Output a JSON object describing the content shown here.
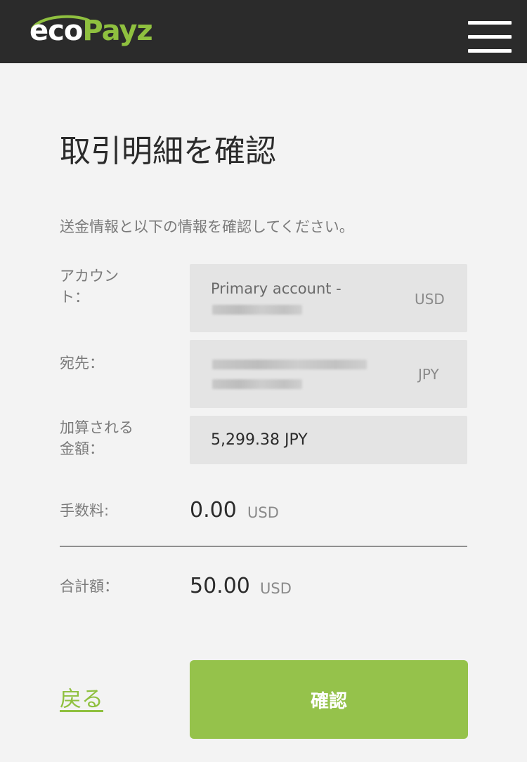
{
  "header": {
    "logo_eco": "eco",
    "logo_payz": "Payz",
    "menu_icon": "hamburger-menu-icon"
  },
  "page": {
    "title": "取引明細を確認",
    "subtitle": "送金情報と以下の情報を確認してください。"
  },
  "fields": {
    "account": {
      "label_line1": "アカウン",
      "label_line2": "ト：",
      "value": "Primary account -",
      "currency": "USD"
    },
    "recipient": {
      "label": "宛先：",
      "currency": "JPY"
    },
    "credited_amount": {
      "label_line1": "加算される",
      "label_line2": "金額：",
      "value": "5,299.38 JPY"
    },
    "fee": {
      "label": "手数料:",
      "value": "0.00",
      "currency": "USD"
    },
    "total": {
      "label": "合計額：",
      "value": "50.00",
      "currency": "USD"
    }
  },
  "actions": {
    "back_label": "戻る",
    "confirm_label": "確認"
  },
  "colors": {
    "brand_green": "#8fc03f",
    "button_green": "#95c24b",
    "header_bg": "#2b2b2b",
    "page_bg": "#f3f3f3",
    "field_bg": "#e4e4e4"
  }
}
